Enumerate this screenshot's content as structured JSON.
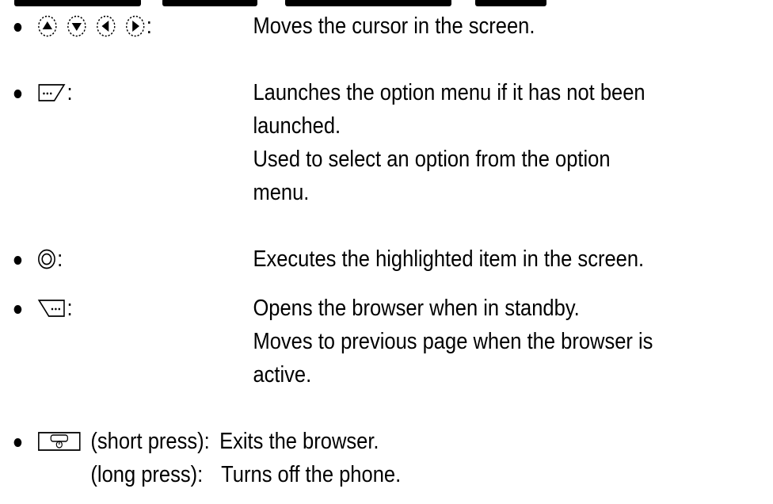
{
  "items": [
    {
      "keys_icons": [
        "up-arrow-key-icon",
        "down-arrow-key-icon",
        "left-arrow-key-icon",
        "right-arrow-key-icon"
      ],
      "colon": ":",
      "lines": [
        "Moves the cursor in the screen."
      ]
    },
    {
      "keys_icons": [
        "option-menu-key-icon"
      ],
      "colon": ":",
      "lines": [
        "Launches the option menu if it has not been",
        "launched.",
        "Used to select an option from the option",
        "menu."
      ]
    },
    {
      "keys_icons": [
        "center-select-key-icon"
      ],
      "colon": ":",
      "lines": [
        "Executes the highlighted item in the screen."
      ]
    },
    {
      "keys_icons": [
        "browser-key-icon"
      ],
      "colon": ":",
      "lines": [
        "Opens the browser when in standby.",
        "Moves to previous page when the browser is",
        "active."
      ]
    },
    {
      "keys_icons": [
        "end-power-key-icon"
      ],
      "short_label": "(short press):",
      "short_desc": "Exits the browser.",
      "long_label": "(long press):",
      "long_desc": "Turns off the phone."
    }
  ]
}
